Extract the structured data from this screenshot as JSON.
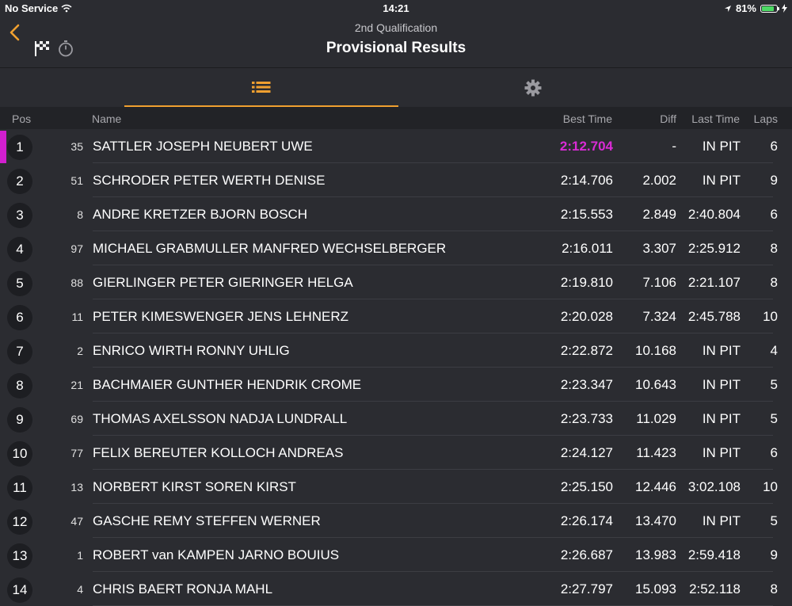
{
  "statusbar": {
    "carrier": "No Service",
    "time": "14:21",
    "battery": "81%",
    "battery_level": 0.81
  },
  "header": {
    "subtitle": "2nd Qualification",
    "title": "Provisional Results"
  },
  "columns": {
    "pos": "Pos",
    "name": "Name",
    "best": "Best Time",
    "diff": "Diff",
    "last": "Last Time",
    "laps": "Laps"
  },
  "colors": {
    "accent": "#f0a030",
    "fastest": "#d92bd5",
    "background": "#2b2c31"
  },
  "rows": [
    {
      "pos": "1",
      "num": "35",
      "name": "SATTLER JOSEPH NEUBERT UWE",
      "best": "2:12.704",
      "diff": "-",
      "last": "IN PIT",
      "laps": "6",
      "fastest": true
    },
    {
      "pos": "2",
      "num": "51",
      "name": "SCHRODER PETER WERTH DENISE",
      "best": "2:14.706",
      "diff": "2.002",
      "last": "IN PIT",
      "laps": "9"
    },
    {
      "pos": "3",
      "num": "8",
      "name": "ANDRE KRETZER BJORN BOSCH",
      "best": "2:15.553",
      "diff": "2.849",
      "last": "2:40.804",
      "laps": "6"
    },
    {
      "pos": "4",
      "num": "97",
      "name": "MICHAEL GRABMULLER MANFRED WECHSELBERGER",
      "best": "2:16.011",
      "diff": "3.307",
      "last": "2:25.912",
      "laps": "8"
    },
    {
      "pos": "5",
      "num": "88",
      "name": "GIERLINGER PETER GIERINGER HELGA",
      "best": "2:19.810",
      "diff": "7.106",
      "last": "2:21.107",
      "laps": "8"
    },
    {
      "pos": "6",
      "num": "11",
      "name": "PETER KIMESWENGER JENS LEHNERZ",
      "best": "2:20.028",
      "diff": "7.324",
      "last": "2:45.788",
      "laps": "10"
    },
    {
      "pos": "7",
      "num": "2",
      "name": "ENRICO WIRTH RONNY UHLIG",
      "best": "2:22.872",
      "diff": "10.168",
      "last": "IN PIT",
      "laps": "4"
    },
    {
      "pos": "8",
      "num": "21",
      "name": "BACHMAIER GUNTHER HENDRIK CROME",
      "best": "2:23.347",
      "diff": "10.643",
      "last": "IN PIT",
      "laps": "5"
    },
    {
      "pos": "9",
      "num": "69",
      "name": "THOMAS AXELSSON NADJA LUNDRALL",
      "best": "2:23.733",
      "diff": "11.029",
      "last": "IN PIT",
      "laps": "5"
    },
    {
      "pos": "10",
      "num": "77",
      "name": "FELIX BEREUTER KOLLOCH ANDREAS",
      "best": "2:24.127",
      "diff": "11.423",
      "last": "IN PIT",
      "laps": "6"
    },
    {
      "pos": "11",
      "num": "13",
      "name": "NORBERT KIRST SOREN KIRST",
      "best": "2:25.150",
      "diff": "12.446",
      "last": "3:02.108",
      "laps": "10"
    },
    {
      "pos": "12",
      "num": "47",
      "name": "GASCHE REMY STEFFEN WERNER",
      "best": "2:26.174",
      "diff": "13.470",
      "last": "IN PIT",
      "laps": "5"
    },
    {
      "pos": "13",
      "num": "1",
      "name": "ROBERT van KAMPEN JARNO BOUIUS",
      "best": "2:26.687",
      "diff": "13.983",
      "last": "2:59.418",
      "laps": "9"
    },
    {
      "pos": "14",
      "num": "4",
      "name": "CHRIS BAERT RONJA MAHL",
      "best": "2:27.797",
      "diff": "15.093",
      "last": "2:52.118",
      "laps": "8"
    }
  ]
}
